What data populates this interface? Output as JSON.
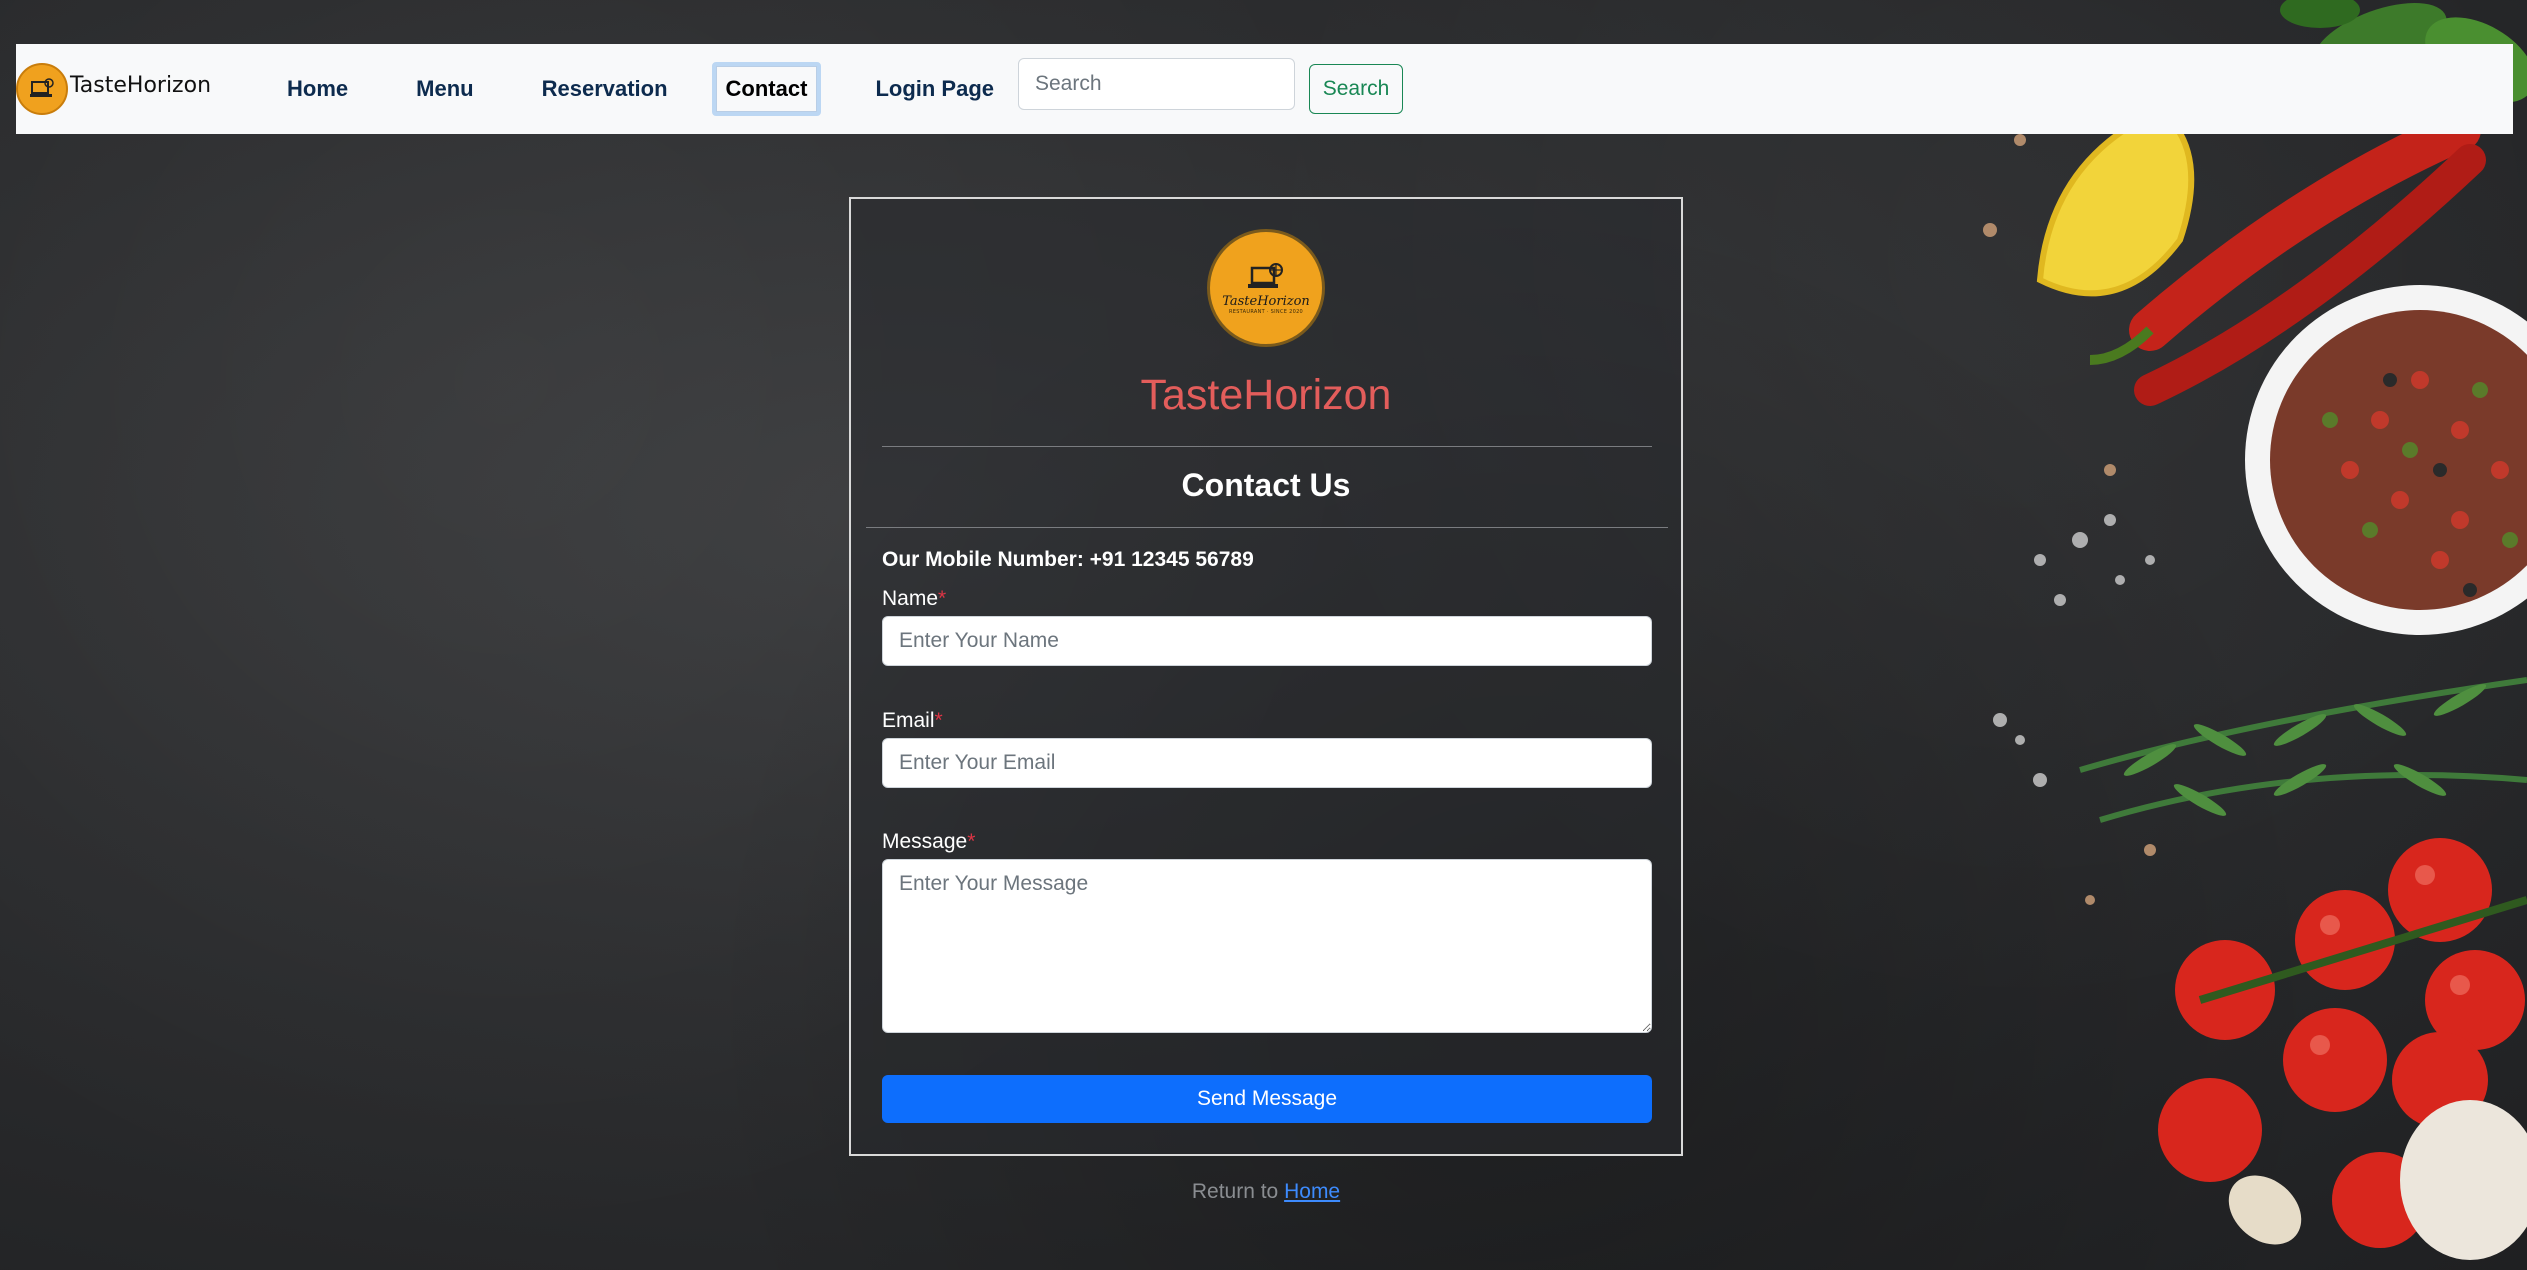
{
  "navbar": {
    "brand": "TasteHorizon",
    "links": [
      {
        "label": "Home"
      },
      {
        "label": "Menu"
      },
      {
        "label": "Reservation"
      },
      {
        "label": "Contact"
      },
      {
        "label": "Login Page"
      }
    ],
    "search_placeholder": "Search",
    "search_button": "Search"
  },
  "card": {
    "logo_text": "TasteHorizon",
    "logo_subtext": "RESTAURANT · SINCE 2020",
    "brand": "TasteHorizon",
    "title": "Contact Us",
    "mobile": "Our Mobile Number: +91 12345 56789",
    "fields": {
      "name_label": "Name",
      "name_placeholder": "Enter Your Name",
      "email_label": "Email",
      "email_placeholder": "Enter Your Email",
      "message_label": "Message",
      "message_placeholder": "Enter Your Message",
      "required_marker": "*"
    },
    "submit": "Send Message"
  },
  "footer": {
    "return_text": "Return to",
    "return_link": "Home"
  },
  "colors": {
    "brand_red": "#e35d5b",
    "primary": "#0d6efd",
    "success": "#198754",
    "logo_orange": "#f0a21d"
  }
}
